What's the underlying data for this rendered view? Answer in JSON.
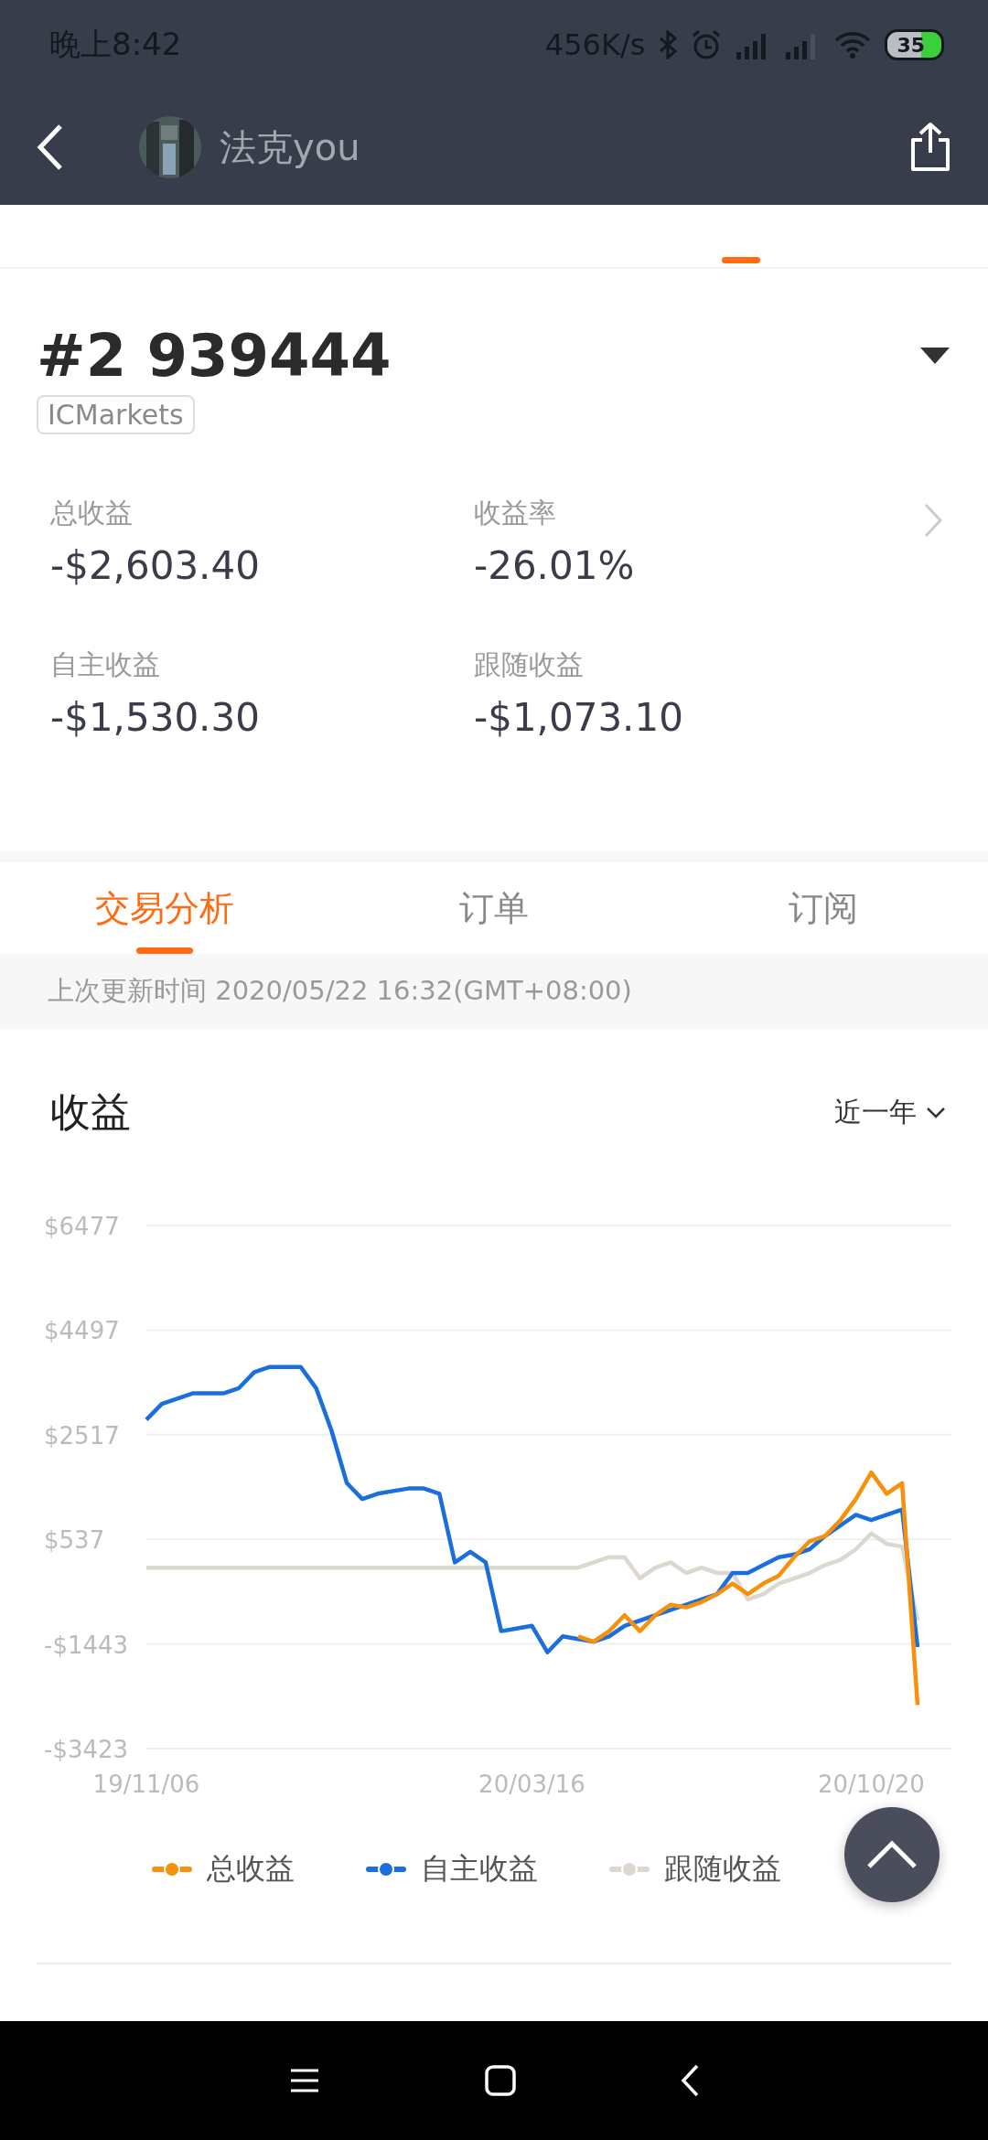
{
  "status_bar": {
    "time": "晚上8:42",
    "speed": "456K/s",
    "battery": "35"
  },
  "header": {
    "title": "法克you"
  },
  "top_tab_indicator": {
    "visible": true
  },
  "account": {
    "number": "#2 939444",
    "broker": "ICMarkets"
  },
  "stats": [
    {
      "label": "总收益",
      "value": "-$2,603.40"
    },
    {
      "label": "收益率",
      "value": "-26.01%"
    },
    {
      "label": "自主收益",
      "value": "-$1,530.30"
    },
    {
      "label": "跟随收益",
      "value": "-$1,073.10"
    }
  ],
  "section_tabs": [
    {
      "label": "交易分析",
      "selected": true
    },
    {
      "label": "订单",
      "selected": false
    },
    {
      "label": "订阅",
      "selected": false
    }
  ],
  "update_note": "上次更新时间 2020/05/22 16:32(GMT+08:00)",
  "chart": {
    "title": "收益",
    "period": "近一年",
    "chart_data": {
      "type": "line",
      "grid": true,
      "categories": [
        "19/11/06",
        null,
        null,
        null,
        null,
        null,
        null,
        null,
        null,
        null,
        null,
        null,
        null,
        null,
        null,
        null,
        null,
        null,
        null,
        null,
        null,
        null,
        null,
        null,
        null,
        "20/03/16",
        null,
        null,
        null,
        null,
        null,
        null,
        null,
        null,
        null,
        null,
        null,
        null,
        null,
        null,
        null,
        null,
        null,
        null,
        null,
        null,
        null,
        "20/10/20",
        null,
        null,
        null
      ],
      "series": [
        {
          "name": "总收益",
          "color": "#f7900a",
          "values": [
            null,
            null,
            null,
            null,
            null,
            null,
            null,
            null,
            null,
            null,
            null,
            null,
            null,
            null,
            null,
            null,
            null,
            null,
            null,
            null,
            null,
            null,
            null,
            null,
            null,
            null,
            null,
            null,
            -1300,
            -1400,
            -1200,
            -900,
            -1200,
            -900,
            -700,
            -750,
            -650,
            -500,
            -300,
            -500,
            -300,
            -150,
            200,
            500,
            600,
            900,
            1300,
            1800,
            1400,
            1600,
            -2600
          ]
        },
        {
          "name": "自主收益",
          "color": "#1a6fdc",
          "values": [
            2800,
            3100,
            3200,
            3300,
            3300,
            3300,
            3400,
            3700,
            3800,
            3800,
            3800,
            3400,
            2600,
            1600,
            1300,
            1400,
            1450,
            1500,
            1500,
            1400,
            100,
            300,
            100,
            -1200,
            -1150,
            -1100,
            -1600,
            -1300,
            -1350,
            -1400,
            -1300,
            -1100,
            -1000,
            -900,
            -800,
            -700,
            -600,
            -500,
            -100,
            -100,
            50,
            200,
            250,
            350,
            600,
            800,
            1000,
            900,
            1000,
            1100,
            -1500
          ]
        },
        {
          "name": "跟随收益",
          "color": "#dcd8d0",
          "values": [
            0,
            0,
            0,
            0,
            0,
            0,
            0,
            0,
            0,
            0,
            0,
            0,
            0,
            0,
            0,
            0,
            0,
            0,
            0,
            0,
            0,
            0,
            0,
            0,
            0,
            0,
            0,
            0,
            0,
            100,
            200,
            200,
            -200,
            0,
            100,
            -100,
            0,
            -100,
            -100,
            -600,
            -500,
            -300,
            -200,
            -100,
            50,
            150,
            350,
            650,
            450,
            400,
            -1000
          ]
        }
      ],
      "ylim": [
        -3423,
        6477
      ],
      "yticks": [
        {
          "value": 6477,
          "label": "$6477"
        },
        {
          "value": 4497,
          "label": "$4497"
        },
        {
          "value": 2517,
          "label": "$2517"
        },
        {
          "value": 537,
          "label": "$537"
        },
        {
          "value": -1443,
          "label": "-$1443"
        },
        {
          "value": -3423,
          "label": "-$3423"
        }
      ]
    }
  }
}
